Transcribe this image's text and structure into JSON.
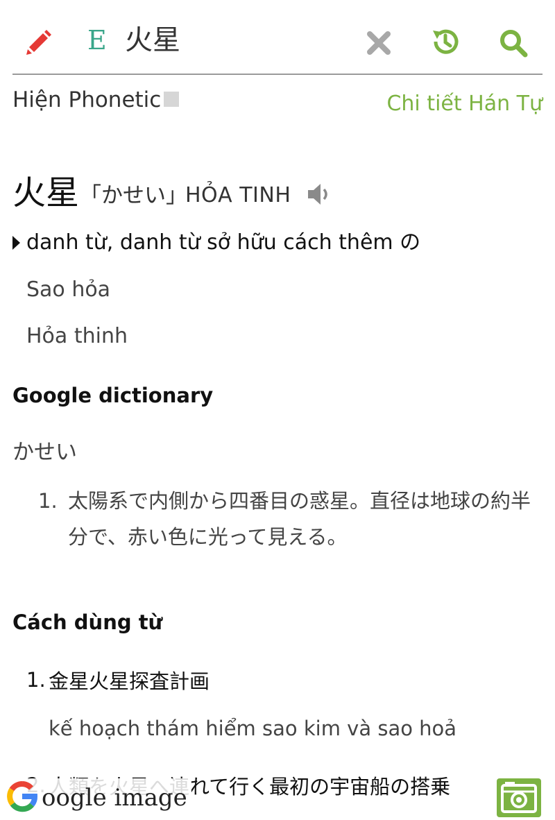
{
  "search": {
    "lang_label": "E",
    "query": "火星"
  },
  "options": {
    "phonetic_label": "Hiện Phonetic",
    "han_tu_link": "Chi tiết Hán Tự"
  },
  "entry": {
    "headword": "火星",
    "reading": "「かせい」",
    "hanviet": "HỎA TINH",
    "pos": "danh từ, danh từ sở hữu cách thêm の",
    "meanings": [
      "Sao hỏa",
      "Hỏa thinh"
    ]
  },
  "google_dictionary": {
    "title": "Google dictionary",
    "reading": "かせい",
    "definitions": [
      {
        "num": "1.",
        "text": "太陽系で内側から四番目の惑星。直径は地球の約半分で、赤い色に光って見える。"
      }
    ]
  },
  "usage": {
    "title": "Cách dùng từ",
    "items": [
      {
        "num": "1.",
        "jp": "金星火星探査計画",
        "vi": "kế hoạch thám hiểm sao kim và sao hoả"
      },
      {
        "num": "2.",
        "jp": "人類を火星へ連れて行く最初の宇宙船の搭乗",
        "vi": ""
      }
    ]
  },
  "bottom": {
    "google_image_label": "oogle image"
  },
  "colors": {
    "accent_green": "#7cb342",
    "lang_teal": "#3aa68a",
    "pencil_red": "#e53935"
  }
}
